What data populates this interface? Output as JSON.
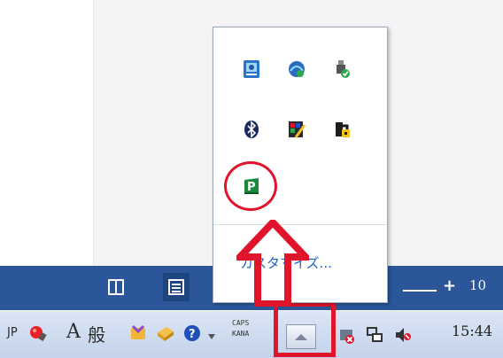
{
  "tray_popup": {
    "customize_label": "カスタマイズ...",
    "icons": [
      "network-globe-icon",
      "network-app-icon",
      "usb-safely-remove-icon",
      "bluetooth-icon",
      "graphics-palette-icon",
      "security-lock-icon",
      "green-p-app-icon"
    ]
  },
  "word_status": {
    "zoom_label": "10",
    "zoom_plus": "+"
  },
  "taskbar": {
    "ime_lang": "JP",
    "ime_mode_a": "A",
    "ime_mode_han": "般",
    "caps_label": "CAPS",
    "kana_label": "KANA",
    "clock": "15:44"
  },
  "annotation": {
    "highlight_color": "#e0142a"
  }
}
